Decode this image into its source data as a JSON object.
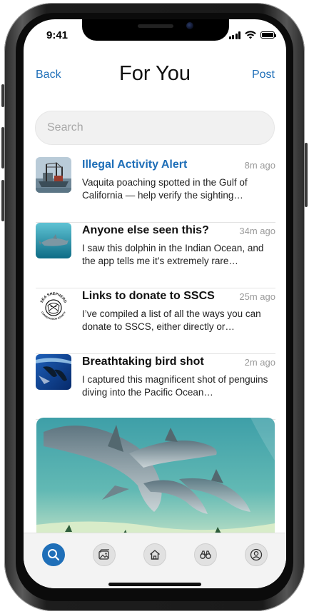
{
  "status_bar": {
    "time": "9:41"
  },
  "nav": {
    "back_label": "Back",
    "title": "For You",
    "post_label": "Post"
  },
  "search": {
    "placeholder": "Search",
    "value": ""
  },
  "feed": [
    {
      "title": "Illegal Activity Alert",
      "time": "8m ago",
      "text": "Vaquita poaching spotted in the Gulf of California — help verify the sighting…",
      "thumb": "fishing-boat-photo",
      "title_color": "#1f6fb8"
    },
    {
      "title": "Anyone else seen this?",
      "time": "34m ago",
      "text": "I saw this dolphin in the Indian Ocean, and the app tells me it’s extremely rare…",
      "thumb": "dolphin-photo"
    },
    {
      "title": "Links to donate to SSCS",
      "time": "25m ago",
      "text": "I’ve compiled a list of all the ways you can donate to SSCS, either directly or…",
      "thumb": "sea-shepherd-logo",
      "logo_text_top": "SEA SHEPHERD",
      "logo_text_bottom": "CONSERVATION SOCIETY"
    },
    {
      "title": "Breathtaking bird shot",
      "time": "2m ago",
      "text": "I captured this magnificent shot of penguins diving into the Pacific Ocean…",
      "thumb": "diving-penguins-photo"
    }
  ],
  "featured_image": "dolphins-underwater-photo",
  "tabbar": {
    "items": [
      {
        "name": "search",
        "icon": "search-icon",
        "active": true
      },
      {
        "name": "gallery",
        "icon": "image-icon",
        "active": false
      },
      {
        "name": "home",
        "icon": "home-icon",
        "active": false
      },
      {
        "name": "binoculars",
        "icon": "binoculars-icon",
        "active": false
      },
      {
        "name": "profile",
        "icon": "user-icon",
        "active": false
      }
    ]
  },
  "colors": {
    "accent": "#1f6fb8",
    "background": "#ffffff",
    "search_bg": "#f1f1f1",
    "tabbar_bg": "#f3f3f3"
  }
}
